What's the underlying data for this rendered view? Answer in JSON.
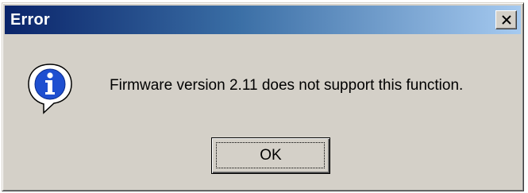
{
  "dialog": {
    "title": "Error",
    "message": "Firmware version 2.11 does not support this function.",
    "icon": "info-icon",
    "close_icon": "close-icon",
    "ok_label": "OK"
  },
  "colors": {
    "titlebar_start": "#0a246a",
    "titlebar_end": "#a6caf0",
    "face": "#d4d0c8",
    "icon_blue": "#1e4fd0"
  }
}
